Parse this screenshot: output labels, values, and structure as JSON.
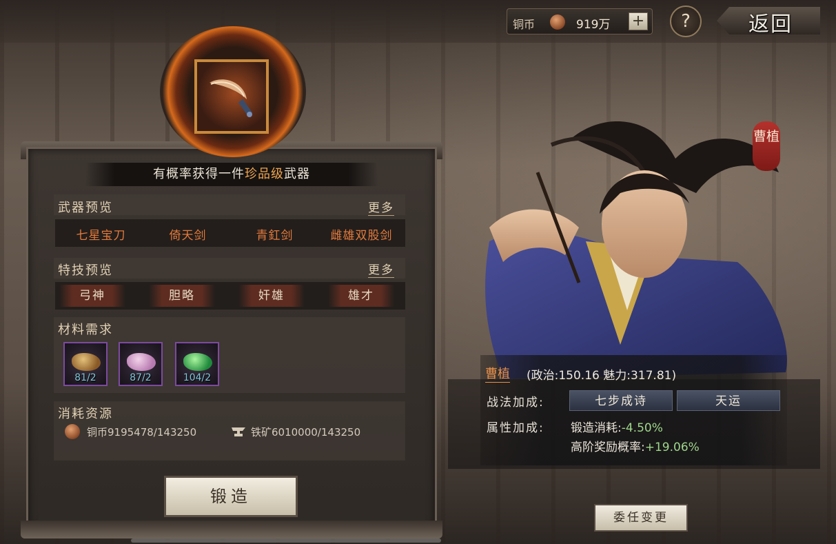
{
  "currency": {
    "label": "铜币",
    "icon": "copper-coin-icon",
    "value": "919万",
    "add_symbol": "+"
  },
  "help_symbol": "?",
  "back_label": "返回",
  "forge_panel": {
    "headline_prefix": "有概率获得一件",
    "headline_highlight": "珍品级",
    "headline_suffix": "武器",
    "weapon_preview": {
      "title": "武器预览",
      "more": "更多",
      "items": [
        "七星宝刀",
        "倚天剑",
        "青釭剑",
        "雌雄双股剑"
      ]
    },
    "skill_preview": {
      "title": "特技预览",
      "more": "更多",
      "items": [
        "弓神",
        "胆略",
        "奸雄",
        "雄才"
      ]
    },
    "materials": {
      "title": "材料需求",
      "items": [
        {
          "count": "81/2",
          "icon": "gold-ore-icon"
        },
        {
          "count": "87/2",
          "icon": "pink-crystal-icon"
        },
        {
          "count": "104/2",
          "icon": "green-jade-icon"
        }
      ]
    },
    "resources": {
      "title": "消耗资源",
      "copper": "铜币9195478/143250",
      "iron": "铁矿6010000/143250"
    },
    "forge_button": "锻造"
  },
  "general": {
    "name_tag": "曹植",
    "name": "曹植",
    "stats": "(政治:150.16 魅力:317.81)",
    "tactic_label": "战法加成:",
    "tactics": [
      "七步成诗",
      "天运"
    ],
    "attr_label": "属性加成:",
    "attr_bonuses": [
      {
        "name": "锻造消耗:",
        "value": "-4.50%"
      },
      {
        "name": "高阶奖励概率:",
        "value": "+19.06%"
      }
    ],
    "appoint_button": "委任变更"
  },
  "colors": {
    "accent_orange": "#e27a3c",
    "bonus_green": "#9fd78a",
    "name_tag_red": "#b4312c"
  }
}
